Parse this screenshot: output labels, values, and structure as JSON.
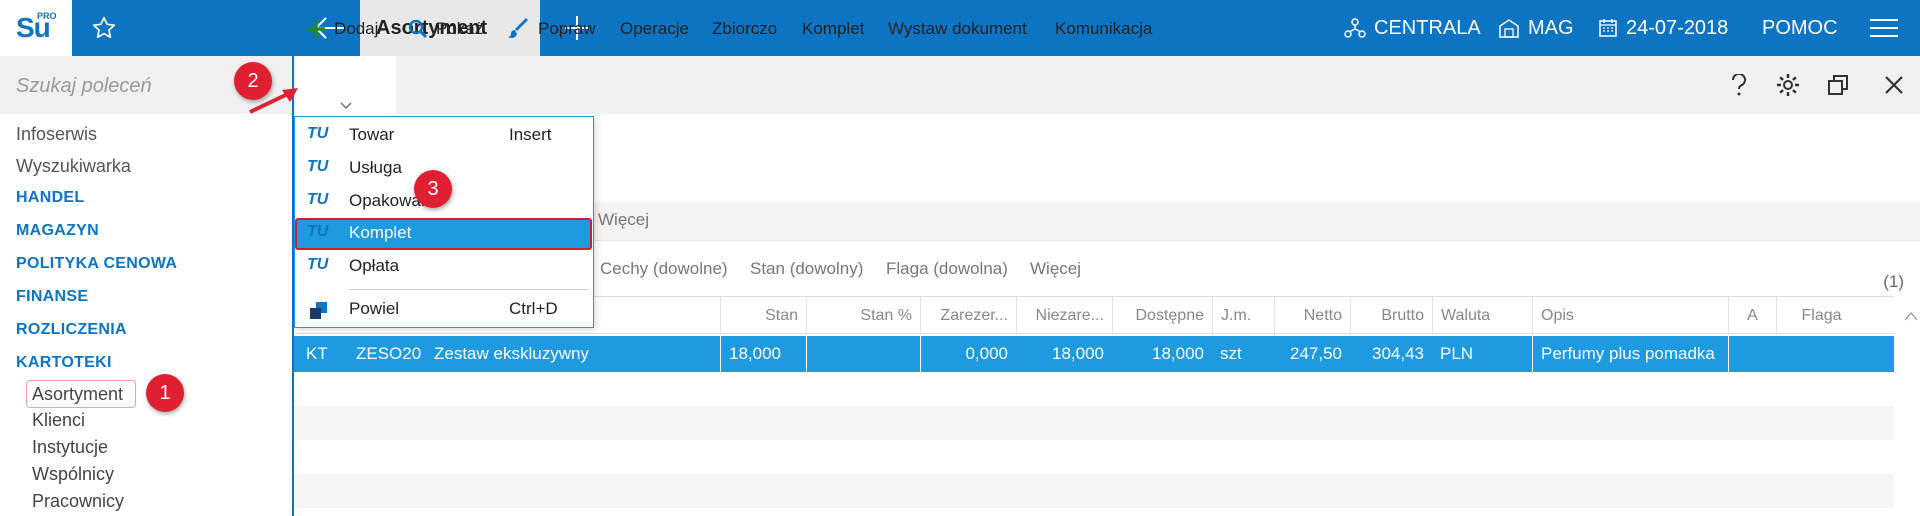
{
  "app": {
    "logo_main": "Su",
    "logo_sup": "PRO",
    "active_tab": "Asortyment"
  },
  "topbar_right": {
    "centrala": "CENTRALA",
    "mag": "MAG",
    "date": "24-07-2018",
    "help": "POMOC"
  },
  "sidebar": {
    "search_placeholder": "Szukaj poleceń",
    "top_items": [
      "Infoserwis",
      "Wyszukiwarka"
    ],
    "sections": [
      "HANDEL",
      "MAGAZYN",
      "POLITYKA CENOWA",
      "FINANSE",
      "ROZLICZENIA",
      "KARTOTEKI"
    ],
    "sub_items": [
      "Asortyment",
      "Klienci",
      "Instytucje",
      "Wspólnicy",
      "Pracownicy"
    ]
  },
  "toolbar": {
    "add": "Dodaj",
    "show": "Pokaż",
    "edit": "Popraw",
    "operations": "Operacje",
    "collection": "Zbiorczo",
    "set": "Komplet",
    "issue_document": "Wystaw dokument",
    "communication": "Komunikacja"
  },
  "filters": {
    "row1_more": "Więcej",
    "features": "Cechy (dowolne)",
    "state": "Stan (dowolny)",
    "flag": "Flaga (dowolna)",
    "row2_more": "Więcej",
    "count": "(1)"
  },
  "table": {
    "columns": [
      "Stan",
      "Stan %",
      "Zarezer...",
      "Niezare...",
      "Dostępne",
      "J.m.",
      "Netto",
      "Brutto",
      "Waluta",
      "Opis",
      "A",
      "Flaga"
    ],
    "rows": [
      {
        "type": "KT",
        "code": "ZESO20",
        "name": "Zestaw ekskluzywny",
        "stan": "18,000",
        "stan_pct": "",
        "zarezerwowane": "0,000",
        "niezarezerwowane": "18,000",
        "dostepne": "18,000",
        "jm": "szt",
        "netto": "247,50",
        "brutto": "304,43",
        "waluta": "PLN",
        "opis": "Perfumy plus pomadka"
      }
    ]
  },
  "dropdown": {
    "items": [
      {
        "tag": "TU",
        "label": "Towar",
        "shortcut": "Insert"
      },
      {
        "tag": "TU",
        "label": "Usługa",
        "shortcut": ""
      },
      {
        "tag": "TU",
        "label": "Opakowanie",
        "shortcut": ""
      },
      {
        "tag": "TU",
        "label": "Komplet",
        "shortcut": ""
      },
      {
        "tag": "TU",
        "label": "Opłata",
        "shortcut": ""
      },
      {
        "tag": "",
        "label": "Powiel",
        "shortcut": "Ctrl+D"
      }
    ]
  },
  "annotations": {
    "badge1": "1",
    "badge2": "2",
    "badge3": "3"
  },
  "colors": {
    "brand_blue": "#0c74c2",
    "selection_blue": "#1d9ae0",
    "annotation_red": "#e02030"
  }
}
